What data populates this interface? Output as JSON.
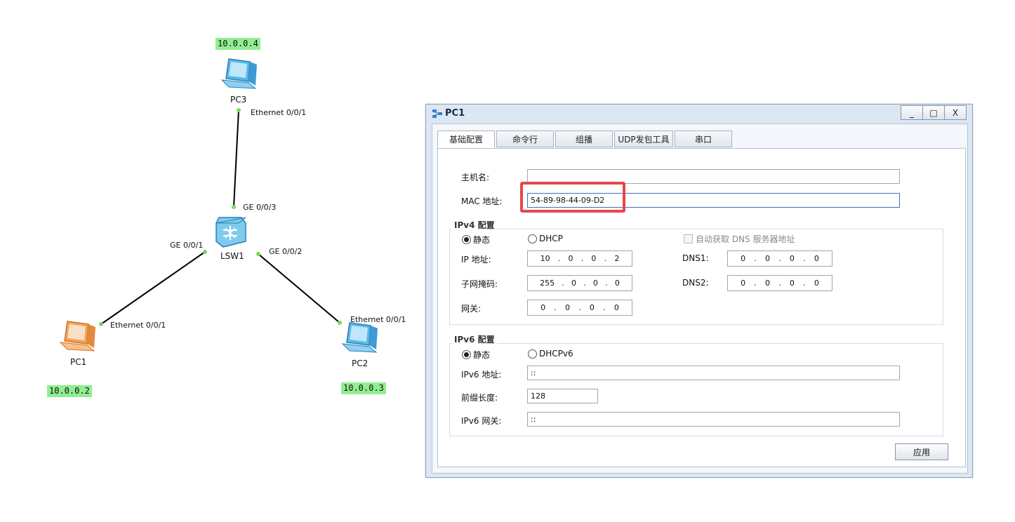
{
  "topology": {
    "devices": [
      {
        "id": "pc3",
        "name": "PC3",
        "ip": "10.0.0.4"
      },
      {
        "id": "lsw1",
        "name": "LSW1"
      },
      {
        "id": "pc1",
        "name": "PC1",
        "ip": "10.0.0.2"
      },
      {
        "id": "pc2",
        "name": "PC2",
        "ip": "10.0.0.3"
      }
    ],
    "ports": {
      "pc3_eth": "Ethernet 0/0/1",
      "lsw_ge3": "GE 0/0/3",
      "lsw_ge1": "GE 0/0/1",
      "lsw_ge2": "GE 0/0/2",
      "pc1_eth": "Ethernet 0/0/1",
      "pc2_eth": "Ethernet 0/0/1"
    },
    "link_color": "#000000",
    "port_dot_color": "#7ed957",
    "ip_label_bg": "#90ee90"
  },
  "window": {
    "title": "PC1",
    "controls": {
      "minimize": "_",
      "maximize": "□",
      "close": "X"
    },
    "tabs": [
      {
        "label": "基础配置",
        "active": true
      },
      {
        "label": "命令行",
        "active": false
      },
      {
        "label": "组播",
        "active": false
      },
      {
        "label": "UDP发包工具",
        "active": false
      },
      {
        "label": "串口",
        "active": false
      }
    ],
    "basic": {
      "hostname_label": "主机名:",
      "hostname_value": "",
      "mac_label": "MAC 地址:",
      "mac_value": "54-89-98-44-09-D2"
    },
    "ipv4": {
      "group_title": "IPv4 配置",
      "static_label": "静态",
      "dhcp_label": "DHCP",
      "auto_dns_label": "自动获取 DNS 服务器地址",
      "ip_label": "IP 地址:",
      "ip": [
        "10",
        "0",
        "0",
        "2"
      ],
      "mask_label": "子网掩码:",
      "mask": [
        "255",
        "0",
        "0",
        "0"
      ],
      "gateway_label": "网关:",
      "gateway": [
        "0",
        "0",
        "0",
        "0"
      ],
      "dns1_label": "DNS1:",
      "dns1": [
        "0",
        "0",
        "0",
        "0"
      ],
      "dns2_label": "DNS2:",
      "dns2": [
        "0",
        "0",
        "0",
        "0"
      ],
      "selected": "static"
    },
    "ipv6": {
      "group_title": "IPv6 配置",
      "static_label": "静态",
      "dhcp_label": "DHCPv6",
      "addr_label": "IPv6 地址:",
      "addr_value": "::",
      "prefix_label": "前缀长度:",
      "prefix_value": "128",
      "gw_label": "IPv6 网关:",
      "gw_value": "::",
      "selected": "static"
    },
    "apply_label": "应用"
  },
  "highlight_color": "#e8474a"
}
